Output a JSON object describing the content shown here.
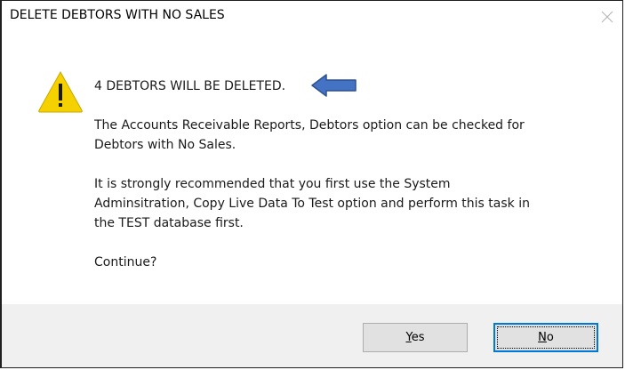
{
  "dialog": {
    "title": "DELETE DEBTORS WITH NO SALES",
    "close_icon": "close-x-icon",
    "warning_icon": "warning-triangle-icon",
    "arrow_icon": "left-pointing-arrow-icon",
    "colors": {
      "warning_fill": "#f5d100",
      "arrow_fill": "#4472c4",
      "arrow_stroke": "#2f528f",
      "focus_border": "#0078d7",
      "footer_bg": "#f0f0f0"
    },
    "message": {
      "headline": "4 DEBTORS WILL BE DELETED.",
      "para1_line1": "The Accounts Receivable Reports, Debtors option can be checked for",
      "para1_line2": "Debtors with No Sales.",
      "para2_line1": "It is strongly recommended that you first use the System",
      "para2_line2": "Adminsitration, Copy Live Data To Test option and perform this task in",
      "para2_line3": "the TEST database first.",
      "question": "Continue?"
    },
    "buttons": {
      "yes": {
        "mnemonic": "Y",
        "rest": "es"
      },
      "no": {
        "mnemonic": "N",
        "rest": "o"
      }
    }
  }
}
